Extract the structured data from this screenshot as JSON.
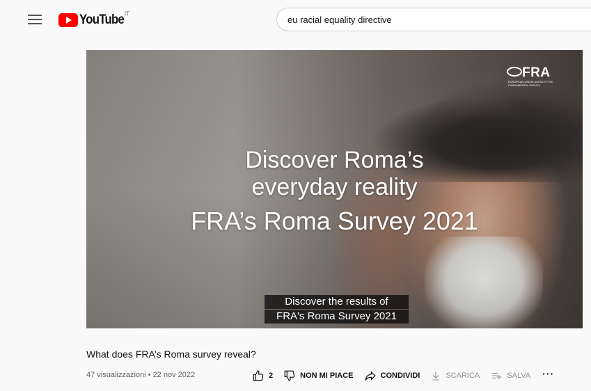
{
  "header": {
    "logo_text": "YouTube",
    "country_code": "IT",
    "search_value": "eu racial equality directive"
  },
  "video": {
    "channel_logo": {
      "word": "FRA",
      "subtitle": "EUROPEAN UNION AGENCY FOR FUNDAMENTAL RIGHTS"
    },
    "overlay_lines": [
      "Discover Roma’s",
      "everyday reality",
      "FRA’s Roma Survey 2021"
    ],
    "captions": [
      "Discover the results of",
      "FRA's Roma Survey 2021"
    ]
  },
  "info": {
    "title": "What does FRA’s Roma survey reveal?",
    "meta": "47 visualizzazioni • 22 nov 2022"
  },
  "actions": {
    "like_count": "2",
    "dislike_label": "NON MI PIACE",
    "share_label": "CONDIVIDI",
    "download_label": "SCARICA",
    "save_label": "SALVA",
    "more_label": "···"
  },
  "icons": [
    "menu-icon",
    "youtube-logo-icon",
    "like-icon",
    "dislike-icon",
    "share-icon",
    "download-icon",
    "save-playlist-icon",
    "more-icon"
  ],
  "colors": {
    "brand_red": "#ff0000",
    "background": "#f9f9f9",
    "text": "#0f0f0f",
    "secondary_text": "#606060",
    "disabled_text": "#909090"
  }
}
